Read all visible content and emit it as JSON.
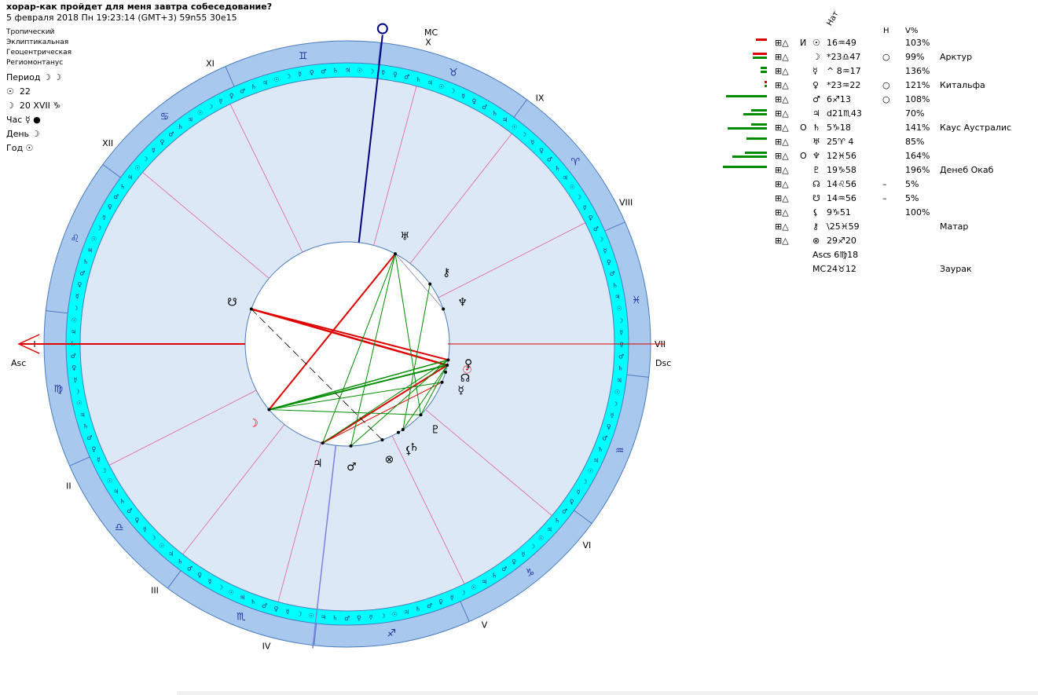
{
  "header": {
    "title": "хорар-как пройдет для меня завтра собеседование?",
    "subtitle": "5 февраля 2018  Пн  19:23:14 (GMT+3) 59n55  30e15"
  },
  "settings": [
    "Тропический",
    "Эклиптикальная",
    "Геоцентрическая",
    "Региомонтанус"
  ],
  "rulers": [
    {
      "label": "Период",
      "value": "☽ ☽"
    },
    {
      "label": "☉",
      "value": "22"
    },
    {
      "label": "☽",
      "value": "20 XVII ♑"
    },
    {
      "label": "Час",
      "value": "☿ ●"
    },
    {
      "label": "День",
      "value": "☽"
    },
    {
      "label": "Год",
      "value": "☉"
    }
  ],
  "angles": {
    "asc": "Asc",
    "dsc": "Dsc",
    "mc": "MC"
  },
  "houses": [
    "I",
    "II",
    "III",
    "IV",
    "V",
    "VI",
    "VII",
    "VIII",
    "IX",
    "X",
    "XI",
    "XII"
  ],
  "signs": [
    "♈",
    "♉",
    "♊",
    "♋",
    "♌",
    "♍",
    "♎",
    "♏",
    "♐",
    "♑",
    "♒",
    "♓"
  ],
  "table_header": {
    "nat": "Нат",
    "h": "H",
    "v": "V%"
  },
  "planets": [
    {
      "glyph": "☉",
      "pos": "16♒49",
      "flag": "И",
      "h": "",
      "v": "103%",
      "star": "",
      "bars": [
        {
          "c": "red",
          "w": 14
        }
      ]
    },
    {
      "glyph": "☽",
      "pos": "*23♎47",
      "flag": "",
      "h": "○",
      "v": "99%",
      "star": "Арктур",
      "bars": [
        {
          "c": "red",
          "w": 18
        },
        {
          "c": "green",
          "w": 18
        }
      ]
    },
    {
      "glyph": "☿",
      "pos": "^ 8♒17",
      "flag": "",
      "h": "",
      "v": "136%",
      "star": "",
      "bars": [
        {
          "c": "green",
          "w": 8
        },
        {
          "c": "green",
          "w": 8
        }
      ]
    },
    {
      "glyph": "♀",
      "pos": "*23♒22",
      "flag": "",
      "h": "○",
      "v": "121%",
      "star": "Китальфа",
      "bars": [
        {
          "c": "red",
          "w": 3
        },
        {
          "c": "green",
          "w": 3
        }
      ]
    },
    {
      "glyph": "♂",
      "pos": "6♐13",
      "flag": "",
      "h": "○",
      "v": "108%",
      "star": "",
      "bars": [
        {
          "c": "green",
          "w": 52
        }
      ]
    },
    {
      "glyph": "♃",
      "pos": "d21♏43",
      "flag": "",
      "h": "",
      "v": "70%",
      "star": "",
      "bars": [
        {
          "c": "green",
          "w": 20
        },
        {
          "c": "green",
          "w": 30
        }
      ]
    },
    {
      "glyph": "♄",
      "pos": "5♑18",
      "flag": "О",
      "h": "",
      "v": "141%",
      "star": "Каус Аустралис",
      "bars": [
        {
          "c": "green",
          "w": 20
        },
        {
          "c": "green",
          "w": 50
        }
      ]
    },
    {
      "glyph": "♅",
      "pos": "25♈ 4",
      "flag": "",
      "h": "",
      "v": "85%",
      "star": "",
      "bars": [
        {
          "c": "green",
          "w": 26
        }
      ]
    },
    {
      "glyph": "♆",
      "pos": "12♓56",
      "flag": "О",
      "h": "",
      "v": "164%",
      "star": "",
      "bars": [
        {
          "c": "green",
          "w": 28
        },
        {
          "c": "green",
          "w": 44
        }
      ]
    },
    {
      "glyph": "♇",
      "pos": "19♑58",
      "flag": "",
      "h": "",
      "v": "196%",
      "star": "Денеб Окаб",
      "bars": [
        {
          "c": "green",
          "w": 56
        }
      ]
    },
    {
      "glyph": "☊",
      "pos": "14♌56",
      "flag": "",
      "h": "–",
      "v": "5%",
      "star": "",
      "bars": []
    },
    {
      "glyph": "☋",
      "pos": "14♒56",
      "flag": "",
      "h": "–",
      "v": "5%",
      "star": "",
      "bars": []
    },
    {
      "glyph": "⚸",
      "pos": "9♑51",
      "flag": "",
      "h": "",
      "v": "100%",
      "star": "",
      "bars": []
    },
    {
      "glyph": "⚷",
      "pos": "\\25♓59",
      "flag": "",
      "h": "",
      "v": "",
      "star": "Матар",
      "bars": []
    },
    {
      "glyph": "⊗",
      "pos": "29♐20",
      "flag": "",
      "h": "",
      "v": "",
      "star": "",
      "bars": []
    },
    {
      "glyph": "Asc",
      "pos": "s 6♍18",
      "flag": "",
      "h": "",
      "v": "",
      "star": "",
      "bars": []
    },
    {
      "glyph": "MC",
      "pos": "24♉12",
      "flag": "",
      "h": "",
      "v": "",
      "star": "Заурак",
      "bars": []
    }
  ],
  "colors": {
    "outer_ring": "#a9c8ee",
    "zodiac_band": "#00ffff",
    "house_area": "#dde8f7",
    "red": "#e00000",
    "green": "#008c00",
    "blue": "#000080"
  }
}
